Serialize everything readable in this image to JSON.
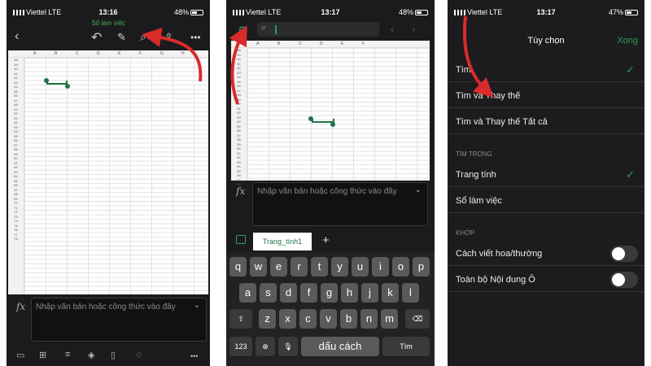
{
  "status": {
    "carrier": "Viettel",
    "network": "LTE",
    "times": [
      "13:16",
      "13:17",
      "13:17"
    ],
    "battery": [
      "48%",
      "48%",
      "47%"
    ]
  },
  "panel1": {
    "doc_title": "Sổ làm việc",
    "columns": [
      "A",
      "B",
      "C",
      "D",
      "E",
      "F",
      "G",
      "H"
    ],
    "rows_start": 38,
    "rows_end": 78,
    "formula_placeholder": "Nhập văn bản hoặc công thức vào đây",
    "fx": "fx",
    "icons": [
      "back-icon",
      "undo-icon",
      "pen-icon",
      "search-icon",
      "share-icon",
      "more-icon"
    ]
  },
  "panel2": {
    "columns": [
      "A",
      "B",
      "C",
      "D",
      "E",
      "F"
    ],
    "rows_start": 38,
    "rows_end": 68,
    "formula_placeholder": "Nhập văn bản hoặc công thức vào đây",
    "fx": "fx",
    "sheet_tab": "Trang_tính1",
    "keyboard": {
      "row1": [
        "q",
        "w",
        "e",
        "r",
        "t",
        "y",
        "u",
        "i",
        "o",
        "p"
      ],
      "row2": [
        "a",
        "s",
        "d",
        "f",
        "g",
        "h",
        "j",
        "k",
        "l"
      ],
      "row3": [
        "z",
        "x",
        "c",
        "v",
        "b",
        "n",
        "m"
      ],
      "num_key": "123",
      "space_key": "dấu cách",
      "return_key": "Tìm"
    }
  },
  "panel3": {
    "title": "Tùy chọn",
    "done": "Xong",
    "find_options": [
      {
        "label": "Tìm",
        "checked": true
      },
      {
        "label": "Tìm và Thay thế",
        "checked": false
      },
      {
        "label": "Tìm và Thay thế Tất cả",
        "checked": false
      }
    ],
    "search_in_header": "TÌM TRONG",
    "search_in": [
      {
        "label": "Trang tính",
        "checked": true
      },
      {
        "label": "Sổ làm việc",
        "checked": false
      }
    ],
    "match_header": "KHỚP",
    "match": [
      {
        "label": "Cách viết hoa/thường",
        "on": false
      },
      {
        "label": "Toàn bộ Nội dung Ô",
        "on": false
      }
    ]
  },
  "colors": {
    "accent": "#217346",
    "green_text": "#2e9e5a",
    "arrow": "#d92b2b"
  }
}
